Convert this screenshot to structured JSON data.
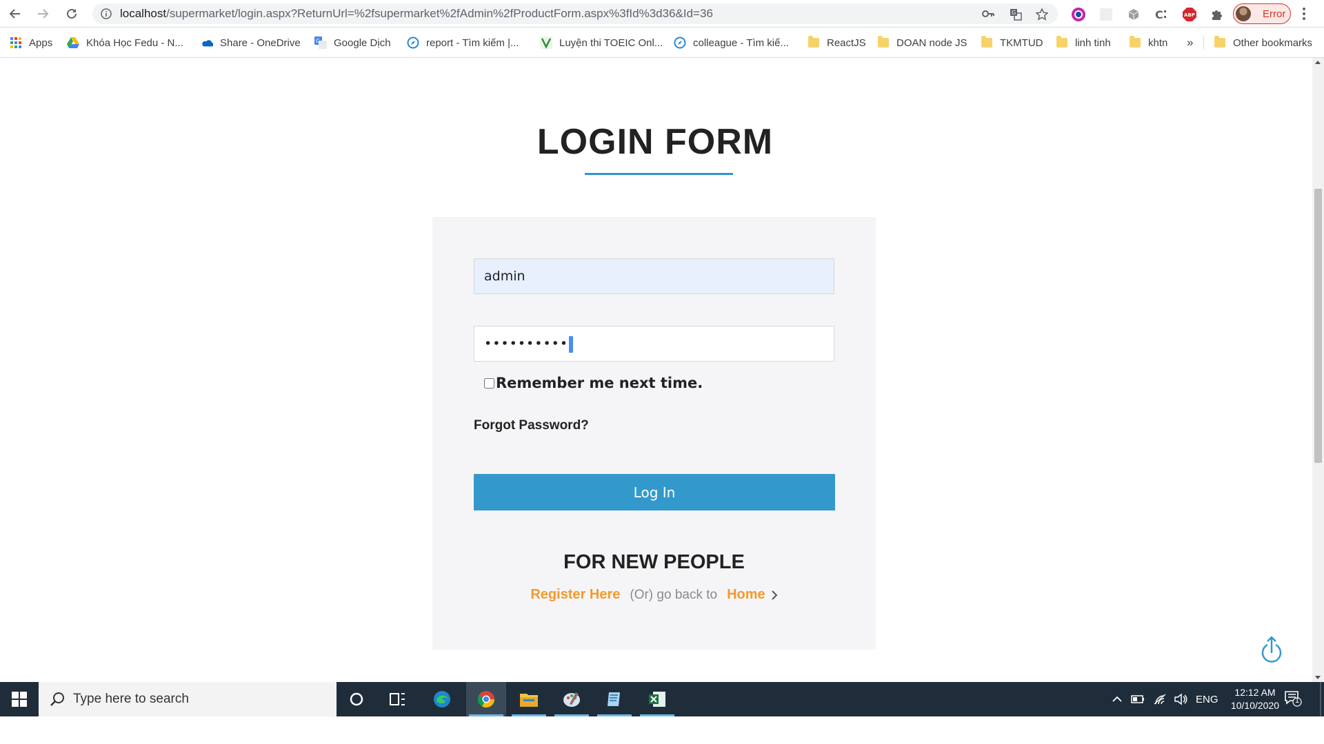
{
  "browser": {
    "url_host": "localhost",
    "url_path": "/supermarket/login.aspx?ReturnUrl=%2fsupermarket%2fAdmin%2fProductForm.aspx%3fId%3d36&Id=36",
    "profile_status": "Error",
    "bookmarks": [
      {
        "label": "Apps",
        "icon": "apps-grid-icon"
      },
      {
        "label": "Khóa Học Fedu - N...",
        "icon": "google-drive-icon"
      },
      {
        "label": "Share - OneDrive",
        "icon": "onedrive-icon"
      },
      {
        "label": "Google Dịch",
        "icon": "google-translate-icon"
      },
      {
        "label": "report - Tìm kiếm |...",
        "icon": "compass-icon"
      },
      {
        "label": "Luyện thi TOEIC Onl...",
        "icon": "toeic-icon"
      },
      {
        "label": "colleague - Tìm kiế...",
        "icon": "compass-icon"
      },
      {
        "label": "ReactJS",
        "icon": "folder-icon"
      },
      {
        "label": "DOAN node JS",
        "icon": "folder-icon"
      },
      {
        "label": "TKMTUD",
        "icon": "folder-icon"
      },
      {
        "label": "linh tinh",
        "icon": "folder-icon"
      },
      {
        "label": "khtn",
        "icon": "folder-icon"
      }
    ],
    "more_bookmarks": "»",
    "other_bookmarks": "Other bookmarks"
  },
  "page": {
    "title": "LOGIN FORM",
    "username_value": "admin",
    "password_masked": "••••••••••",
    "remember_label": "Remember me next time.",
    "forgot_label": "Forgot Password?",
    "login_button": "Log In",
    "new_people_heading": "FOR NEW PEOPLE",
    "register_link": "Register Here",
    "or_text": "(Or) go back to",
    "home_link": "Home"
  },
  "taskbar": {
    "search_placeholder": "Type here to search",
    "language": "ENG",
    "time": "12:12 AM",
    "date": "10/10/2020",
    "notification_count": "1"
  },
  "colors": {
    "accent_blue": "#3399cc",
    "link_orange": "#f39a2c",
    "card_bg": "#f5f5f7",
    "autofill_bg": "#e8f0fe"
  }
}
